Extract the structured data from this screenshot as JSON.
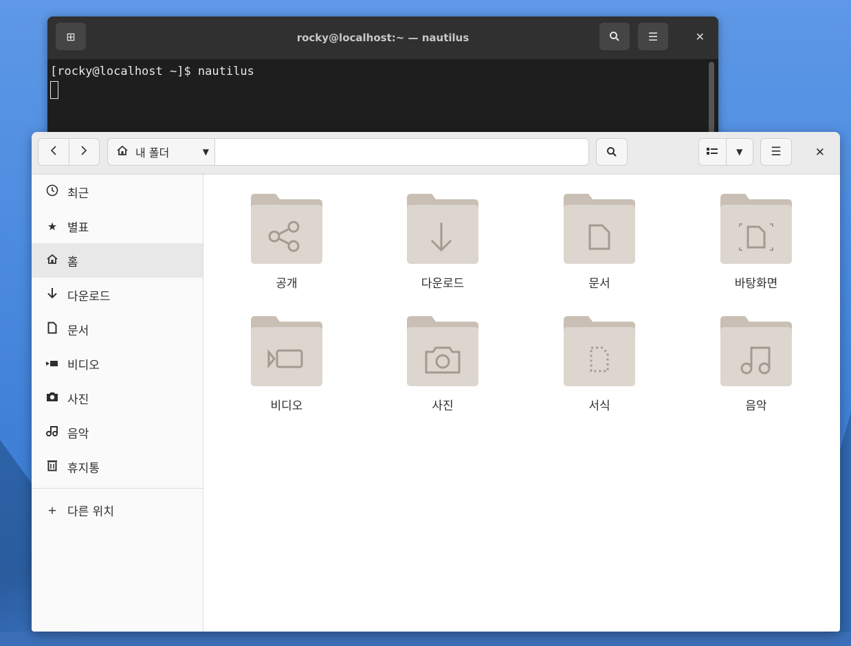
{
  "terminal": {
    "title": "rocky@localhost:~ — nautilus",
    "prompt_line": "[rocky@localhost ~]$ nautilus"
  },
  "filemanager": {
    "path_label": "내 폴더",
    "sidebar": [
      {
        "label": "최근",
        "icon": "clock-icon"
      },
      {
        "label": "별표",
        "icon": "star-icon"
      },
      {
        "label": "홈",
        "icon": "home-icon",
        "active": true
      },
      {
        "label": "다운로드",
        "icon": "download-icon"
      },
      {
        "label": "문서",
        "icon": "document-icon"
      },
      {
        "label": "비디오",
        "icon": "video-icon"
      },
      {
        "label": "사진",
        "icon": "camera-icon"
      },
      {
        "label": "음악",
        "icon": "music-icon"
      },
      {
        "label": "휴지통",
        "icon": "trash-icon"
      }
    ],
    "other_locations": "다른 위치",
    "folders": [
      {
        "label": "공개",
        "icon": "share-icon"
      },
      {
        "label": "다운로드",
        "icon": "download-icon"
      },
      {
        "label": "문서",
        "icon": "document-icon"
      },
      {
        "label": "바탕화면",
        "icon": "desktop-icon"
      },
      {
        "label": "비디오",
        "icon": "video-icon"
      },
      {
        "label": "사진",
        "icon": "camera-icon"
      },
      {
        "label": "서식",
        "icon": "template-icon"
      },
      {
        "label": "음악",
        "icon": "music-icon"
      }
    ]
  }
}
